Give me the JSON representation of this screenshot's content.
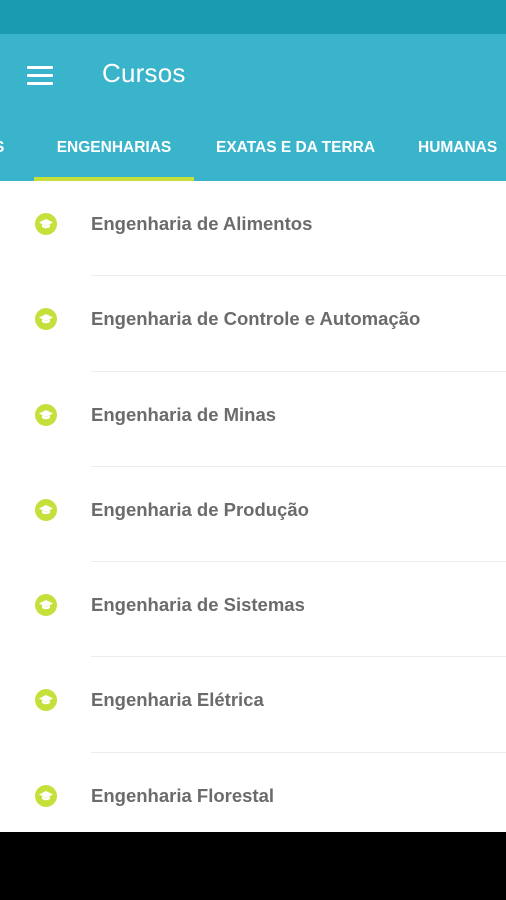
{
  "colors": {
    "status_bar": "#1a9bb0",
    "primary": "#3ab4cb",
    "accent": "#c6df3a",
    "item_text": "#6b6b6b"
  },
  "app_bar": {
    "menu_icon": "hamburger-menu-icon",
    "title": "Cursos"
  },
  "tabs": [
    {
      "label": "S",
      "selected": false
    },
    {
      "label": "ENGENHARIAS",
      "selected": true
    },
    {
      "label": "EXATAS E DA TERRA",
      "selected": false
    },
    {
      "label": "HUMANAS",
      "selected": false
    }
  ],
  "courses": {
    "item_icon": "graduation-cap-icon",
    "items": [
      {
        "label": "Engenharia de Alimentos"
      },
      {
        "label": "Engenharia de Controle e Automação"
      },
      {
        "label": "Engenharia de Minas"
      },
      {
        "label": "Engenharia de Produção"
      },
      {
        "label": "Engenharia de Sistemas"
      },
      {
        "label": "Engenharia Elétrica"
      },
      {
        "label": "Engenharia Florestal"
      }
    ]
  }
}
